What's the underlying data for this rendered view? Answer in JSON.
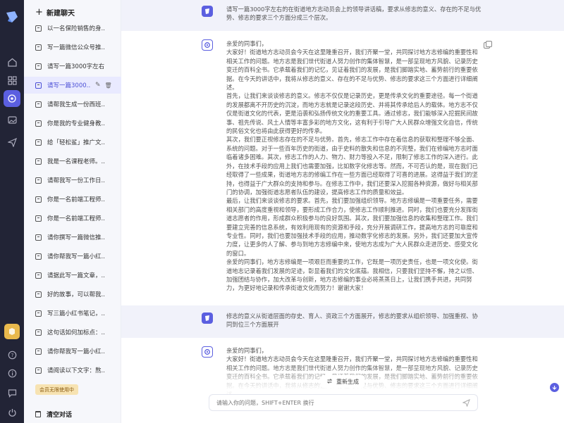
{
  "sidebar": {
    "new_chat": "新建聊天",
    "history": [
      {
        "label": "以一名保险销售的身..."
      },
      {
        "label": "写一篇微信公众号推..."
      },
      {
        "label": "请写一篇3000字左右..."
      },
      {
        "label": "请写一篇3000...",
        "active": true
      },
      {
        "label": "请帮我生成一份西班..."
      },
      {
        "label": "你是我的专业健身教..."
      },
      {
        "label": "给「轻松鲨」推广文..."
      },
      {
        "label": "我是一名课程老师。..."
      },
      {
        "label": "请帮我写一份工作日..."
      },
      {
        "label": "你是一名前端工程师..."
      },
      {
        "label": "你是一名前端工程师..."
      },
      {
        "label": "请你撰写一篇微信推..."
      },
      {
        "label": "请你帮我写一篇小红..."
      },
      {
        "label": "请据此写一篇文章，..."
      },
      {
        "label": "好的故事，可以帮我..."
      },
      {
        "label": "写三篇小红书笔记，..."
      },
      {
        "label": "这句话如何加标点：..."
      },
      {
        "label": "请你帮我写一篇小红..."
      },
      {
        "label": "请阅读以下文字：熬..."
      }
    ],
    "vip_badge": "会员无限使用中",
    "clear_chat": "清空对话"
  },
  "messages": [
    {
      "role": "user",
      "paragraphs": [
        "请写一篇3000字左右的在街道地方志动员会上的领导讲话稿，要求从修志的意义、存在的不足与优势、修志的要求三个方面分成三个层次。"
      ]
    },
    {
      "role": "bot",
      "paragraphs": [
        "亲爱的同事们，",
        "大家好！街道地方志动员会今天在这里隆重召开，我们齐聚一堂，共同探讨地方志修编的重要性和相关工作的问题。地方志是我们世代街道人努力创作的集体智慧，是一部呈现地方风貌、记录历史变迁的百科全书。它承载着我们的记忆，见证着我们的发展，是我们脚踏实地、蓄势前行的重要依据。在今天的讲话中，我将从修志的意义、存在的不足与优势、修志的要求这三个方面进行详细阐述。",
        "首先，让我们来谈谈修志的意义。修志不仅仅是记录历史，更是传承文化的重要途径。每一个街道的发展都离不开历史的沉淀，而地方志就是记录这段历史、并将其传承给后人的载体。地方志不仅仅是街道文化的代表，更是沿袭和弘扬传统文化的重要工具。通过修志，我们能够深入挖掘民间故事、祖先传说、风土人情等丰富多彩的地方文化，这有利于引导广大人民群众增强文化自信，传统的民俗文化也将由此获得更好的传承。",
        "其次，我们要正视修志存在的不足与优势。首先，修志工作中存在着信息的获取和整理不够全面、系统的问题。对于一些百年历史的街道，由于史料的散失和信息的不完整，我们在修编地方志时面临着诸多困难。其次，修志工作的人力、物力、财力等投入不足，限制了修志工作的深入进行。此外，在技术手段的应用上我们也需要加强，比如数字化修志等。然而，不可否认的是，现在我们已经取得了一些成果，街道地方志的修编工作在一些方面已经取得了可喜的进展。这得益于我们的坚持，也得益于广大群众的支持和参与。在修志工作中，我们还要深入挖掘各种资源，做好与相关部门的协调，加强街道志愿者队伍的建设，提高修志工作的质量和效益。",
        "最后，让我们来谈谈修志的要求。首先，我们要加强组织领导。地方志修编是一项重要任务，需要相关部门的高度重视和领导，要形成工作合力，使修志工作顺利推进。同时，我们也要充分发挥街道志愿者的作用，形成群众积极参与的良好氛围。其次，我们要加强信息的收集和整理工作。我们要建立完善的信息系统，有效利用现有的资源和手段，充分开展调研工作，提高地方志的可靠度和专业性。同时，我们也要加强技术手段的应用，推动数字化修志的发展。另外，我们还要加大宣传力度，让更多的人了解、参与到地方志修编中来，使地方志成为广大人民群众走进历史、感受文化的窗口。",
        "亲爱的同事们，地方志修编是一项艰巨而重要的工作，它既是一项历史责任，也是一项文化使。街道地志记录着我们发展的足迹，彰显着我们的文化底蕴。我相信，只要我们坚持不懈，持之以恒、加强团结与协作，加大改革与创新，地方志修编的事业必将蒸蒸日上，让我们携手共进，共同努力，为更好地记录和传承街道文化而努力！谢谢大家！"
      ]
    },
    {
      "role": "user",
      "paragraphs": [
        "修志的意义从街道层面的存史、育人、资政三个方面展开，修志的要求从组织领导、加强重视、协同到位三个方面展开"
      ]
    },
    {
      "role": "bot",
      "paragraphs": [
        "亲爱的同事们，",
        "大家好！街道地方志动员会今天在这里隆重召开，我们齐聚一堂，共同探讨地方志修编的重要性和相关工作的问题。地方志是我们世代街道人努力创作的集体智慧，是一部呈现地方风貌、记录历史变迁的百科全书。它承载着我们的记忆，见证着我们的发展，是我们脚踏实地、蓄势前行的重要依据。在今天的讲话中，我将从修志的意义、存在的不足与优势、修志的要求这三个方面进行详细阐述。"
      ]
    }
  ],
  "regenerate_label": "重新生成",
  "input": {
    "placeholder": "请输入你的问题，SHIFT+ENTER 换行"
  },
  "colors": {
    "accent": "#5b5fe0",
    "rail_bg": "#222436",
    "sidebar_bg": "#f6f7fb",
    "user_msg_bg": "#f1f2fa"
  }
}
